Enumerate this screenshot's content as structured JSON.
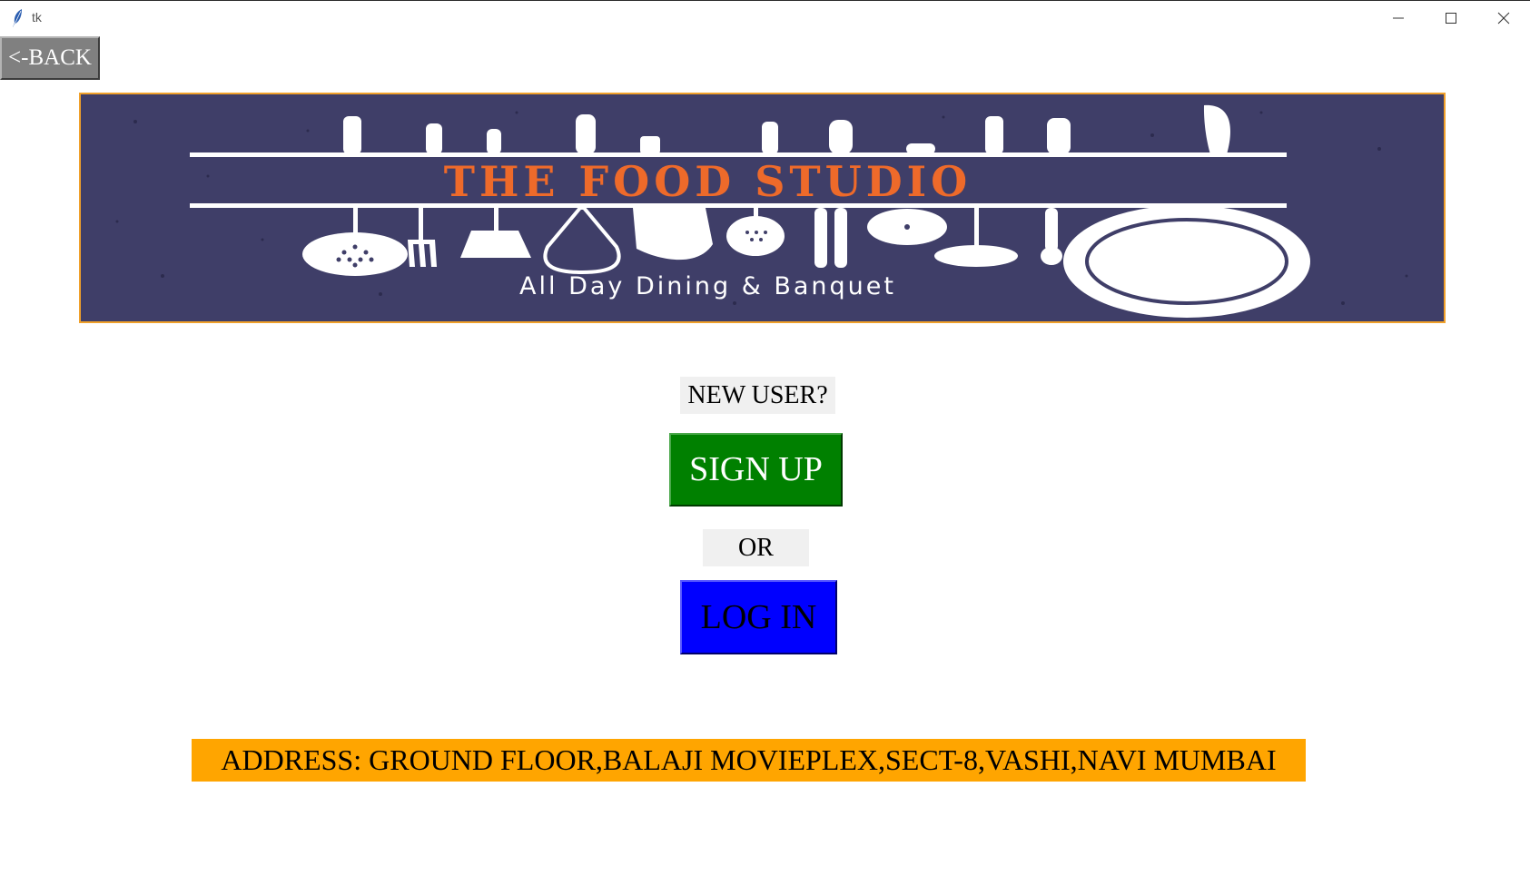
{
  "window": {
    "title": "tk"
  },
  "toolbar": {
    "back_label": "<-BACK"
  },
  "banner": {
    "title": "THE FOOD STUDIO",
    "subtitle": "All Day Dining & Banquet"
  },
  "main": {
    "new_user_label": "NEW USER?",
    "signup_label": "SIGN UP",
    "or_label": "OR",
    "login_label": "LOG IN"
  },
  "footer": {
    "address": "ADDRESS: GROUND FLOOR,BALAJI MOVIEPLEX,SECT-8,VASHI,NAVI MUMBAI"
  },
  "colors": {
    "back_button": "#808080",
    "banner_bg": "#3f3e68",
    "banner_border": "#f0a02a",
    "banner_title": "#ee6a2a",
    "signup": "#008000",
    "login": "#0000ff",
    "address_bg": "#ffa500"
  },
  "icons": {
    "app": "feather-icon",
    "minimize": "minimize-icon",
    "maximize": "maximize-icon",
    "close": "close-icon"
  }
}
